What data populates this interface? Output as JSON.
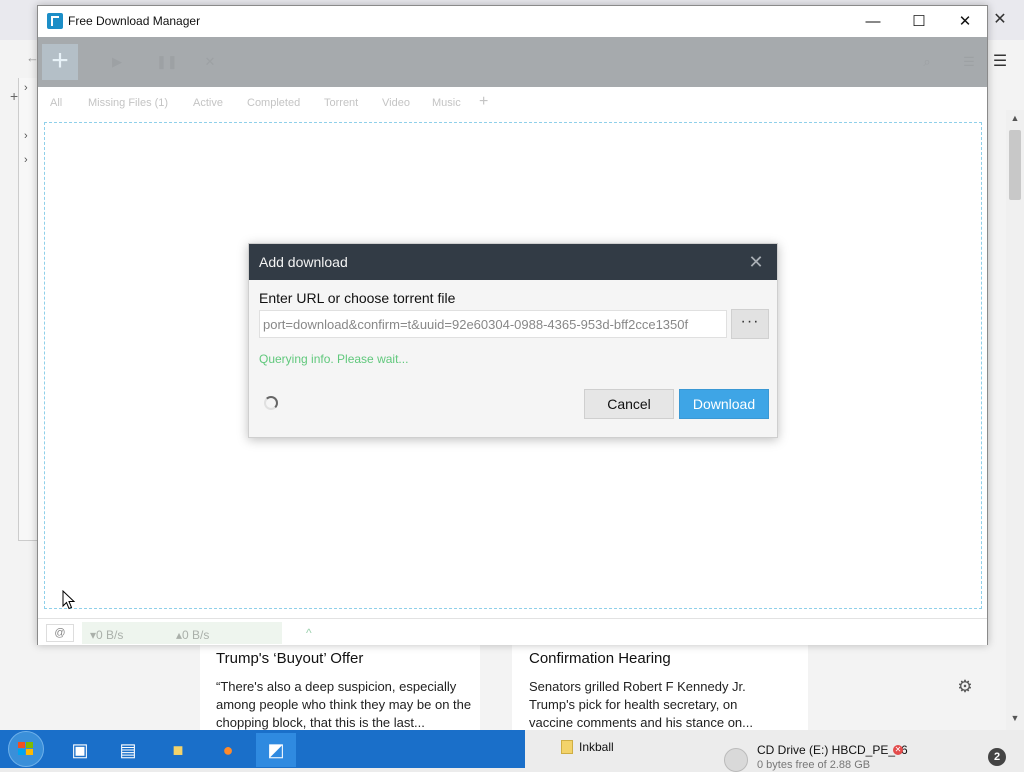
{
  "window": {
    "title": "Free Download Manager",
    "controls": {
      "minimize": "—",
      "maximize": "☐",
      "close": "✕"
    }
  },
  "toolbar": {
    "add_symbol": "+"
  },
  "tabs": [
    {
      "label": "All"
    },
    {
      "label": "Missing Files (1)"
    },
    {
      "label": "Active"
    },
    {
      "label": "Completed"
    },
    {
      "label": "Torrent"
    },
    {
      "label": "Video"
    },
    {
      "label": "Music"
    }
  ],
  "tab_add": "+",
  "dialog": {
    "title": "Add download",
    "close": "✕",
    "label": "Enter URL or choose torrent file",
    "url_value": "port=download&confirm=t&uuid=92e60304-0988-4365-953d-bff2cce1350f",
    "browse_label": "···",
    "status": "Querying info. Please wait...",
    "cancel_label": "Cancel",
    "download_label": "Download"
  },
  "statusbar": {
    "download_speed": "▾0 B/s",
    "upload_speed": "▴0 B/s",
    "expand": "^"
  },
  "background_news": [
    {
      "title": "Trump's ‘Buyout’ Offer",
      "body": "“There's also a deep suspicion, especially among people who think they may be on the chopping block, that this is the last..."
    },
    {
      "title": "Confirmation Hearing",
      "body": "Senators grilled Robert F Kennedy Jr. Trump's pick for health secretary, on vaccine comments and his stance on..."
    }
  ],
  "taskbar": {
    "items": [
      {
        "name": "Inkball",
        "label": "Inkball"
      },
      {
        "name": "cd-drive",
        "label": "CD Drive (E:) HBCD_PE_x6",
        "detail": "0 bytes free of 2.88 GB"
      }
    ],
    "notification_count": "2"
  },
  "colors": {
    "dialog_header": "#323b45",
    "download_button": "#3ea5e6",
    "status_green": "#60c87c",
    "drop_border": "#8fd0ea",
    "taskbar": "#1a6fc9"
  }
}
